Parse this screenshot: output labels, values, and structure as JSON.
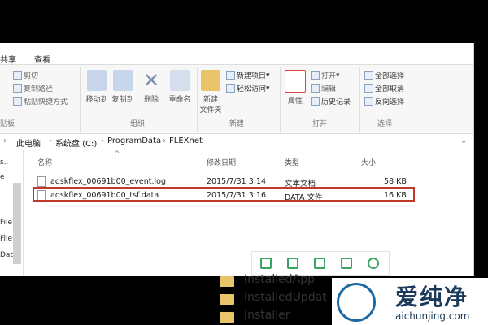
{
  "tabs": [
    "共享",
    "查看"
  ],
  "ribbon": {
    "clipboard_small": [
      "剪切",
      "复制路径",
      "粘贴快捷方式"
    ],
    "organize": {
      "move_to": "移动到",
      "copy_to": "复制到",
      "delete": "删除",
      "rename": "重命名"
    },
    "new": {
      "new_folder_line1": "新建",
      "new_folder_line2": "文件夹",
      "new_item": "新建项目",
      "easy_access": "轻松访问"
    },
    "open": {
      "properties": "属性",
      "open": "打开",
      "edit": "编辑",
      "history": "历史记录"
    },
    "select": {
      "select_all": "全部选择",
      "select_none": "全部取消",
      "invert": "反向选择"
    },
    "groups": {
      "clipboard": "贴板",
      "organize": "组织",
      "new": "新建",
      "open": "打开",
      "select": "选择"
    }
  },
  "address": {
    "crumbs": [
      "此电脑",
      "系统盘 (C:)",
      "ProgramData",
      "FLEXnet"
    ]
  },
  "nav": {
    "items": [
      "s..",
      "e",
      "File",
      "File",
      "Dat"
    ]
  },
  "columns": {
    "name": "名称",
    "date": "修改日期",
    "type": "类型",
    "size": "大小"
  },
  "files": [
    {
      "name": "adskflex_00691b00_event.log",
      "date": "2015/7/31 3:14",
      "type": "文本文档",
      "size": "58 KB"
    },
    {
      "name": "adskflex_00691b00_tsf.data",
      "date": "2015/7/31 3:16",
      "type": "DATA 文件",
      "size": "16 KB"
    }
  ],
  "tree": [
    "InstalledApp",
    "InstalledUpdat",
    "Installer"
  ],
  "watermark": {
    "title": "爱纯净",
    "url": "aichunjing.com"
  }
}
